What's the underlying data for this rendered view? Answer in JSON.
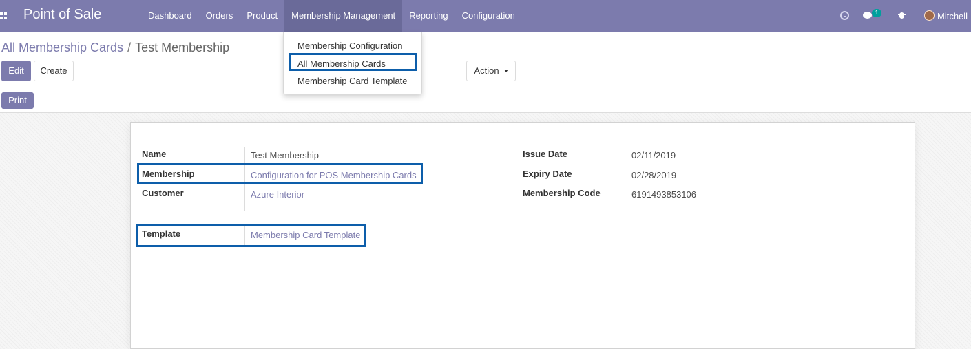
{
  "navbar": {
    "brand": "Point of Sale",
    "menu": [
      "Dashboard",
      "Orders",
      "Product",
      "Membership Management",
      "Reporting",
      "Configuration"
    ],
    "chat_count": "1",
    "user_name": "Mitchell"
  },
  "dropdown": {
    "items": [
      "Membership Configuration",
      "All Membership Cards",
      "Membership Card Template"
    ]
  },
  "breadcrumb": {
    "parent": "All Membership Cards",
    "separator": "/",
    "current": "Test Membership"
  },
  "buttons": {
    "edit": "Edit",
    "create": "Create",
    "action": "Action",
    "print": "Print"
  },
  "form": {
    "name_label": "Name",
    "name_value": "Test Membership",
    "membership_label": "Membership",
    "membership_value": "Configuration for POS Membership Cards",
    "customer_label": "Customer",
    "customer_value": "Azure Interior",
    "template_label": "Template",
    "template_value": "Membership Card Template",
    "issue_date_label": "Issue Date",
    "issue_date_value": "02/11/2019",
    "expiry_date_label": "Expiry Date",
    "expiry_date_value": "02/28/2019",
    "membership_code_label": "Membership Code",
    "membership_code_value": "6191493853106"
  },
  "colors": {
    "brand": "#7c7bad",
    "highlight": "#0d5eaa"
  }
}
